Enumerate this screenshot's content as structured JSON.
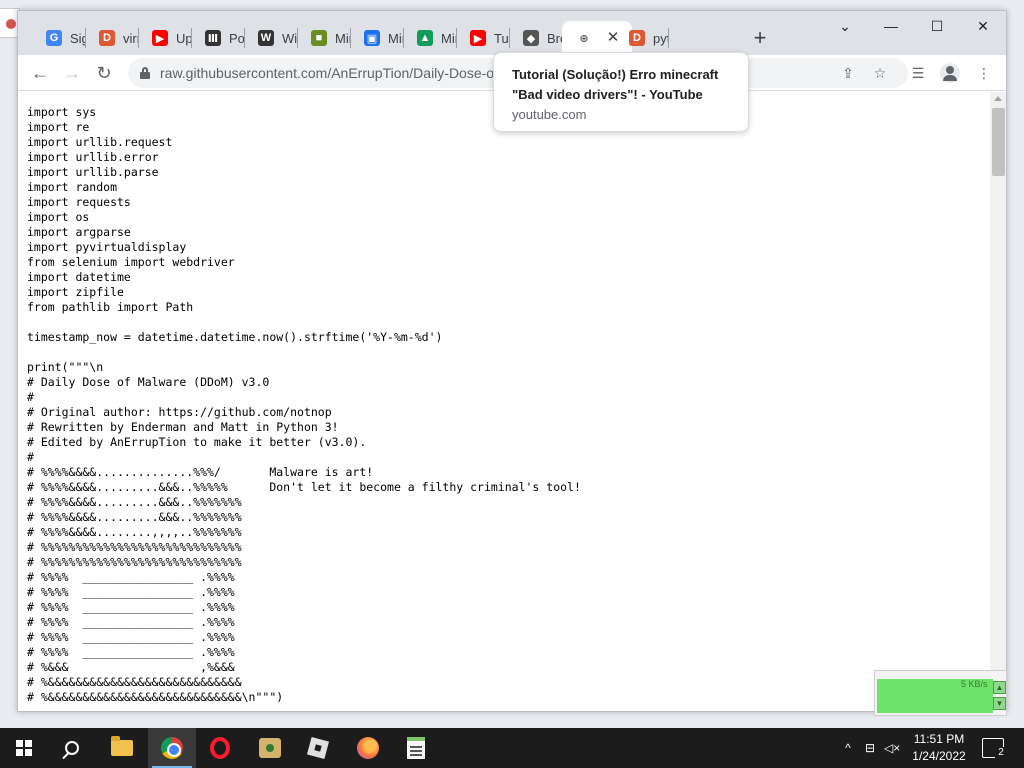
{
  "browser": {
    "tabs": [
      {
        "title": "Sign",
        "icon": "G",
        "color": "#4285f4"
      },
      {
        "title": "virn",
        "icon": "D",
        "color": "#de5833"
      },
      {
        "title": "Upd",
        "icon": "▶",
        "color": "#ff0000"
      },
      {
        "title": "Pos",
        "icon": "Ⅲ",
        "color": "#333333"
      },
      {
        "title": "Wir",
        "icon": "W",
        "color": "#333333"
      },
      {
        "title": "Min",
        "icon": "■",
        "color": "#6b8e23"
      },
      {
        "title": "Min",
        "icon": "▣",
        "color": "#1a73e8"
      },
      {
        "title": "Min",
        "icon": "▲",
        "color": "#0f9d58"
      },
      {
        "title": "Tuto",
        "icon": "▶",
        "color": "#ff0000"
      },
      {
        "title": "Bro",
        "icon": "◆",
        "color": "#555555"
      },
      {
        "title": "",
        "icon": "⊕",
        "color": "#5f6368",
        "active": true
      },
      {
        "title": "pyth",
        "icon": "D",
        "color": "#de5833"
      }
    ],
    "new_tab_symbol": "+",
    "window_controls": {
      "dropdown": "⌄",
      "minimize": "—",
      "maximize": "☐",
      "close": "✕"
    },
    "nav": {
      "back": "←",
      "forward": "→",
      "reload": "↻"
    },
    "address_bar": {
      "url": "raw.githubusercontent.com/AnErrupTion/Daily-Dose-of"
    },
    "toolbar_icons": {
      "share": "⇪",
      "bookmark": "☆",
      "reading_list": "☰",
      "menu": "⋮"
    }
  },
  "tooltip": {
    "title_line1": "Tutorial (Solução!) Erro minecraft",
    "title_line2": "\"Bad video drivers\"! - YouTube",
    "host": "youtube.com"
  },
  "code_lines": [
    "import sys",
    "import re",
    "import urllib.request",
    "import urllib.error",
    "import urllib.parse",
    "import random",
    "import requests",
    "import os",
    "import argparse",
    "import pyvirtualdisplay",
    "from selenium import webdriver",
    "import datetime",
    "import zipfile",
    "from pathlib import Path",
    "",
    "timestamp_now = datetime.datetime.now().strftime('%Y-%m-%d')",
    "",
    "print(\"\"\"\\n",
    "# Daily Dose of Malware (DDoM) v3.0",
    "#",
    "# Original author: https://github.com/notnop",
    "# Rewritten by Enderman and Matt in Python 3!",
    "# Edited by AnErrupTion to make it better (v3.0).",
    "#",
    "# %%%%&&&&..............%%%/       Malware is art!",
    "# %%%%&&&&.........&&&..%%%%%      Don't let it become a filthy criminal's tool!",
    "# %%%%&&&&.........&&&..%%%%%%%",
    "# %%%%&&&&.........&&&..%%%%%%%",
    "# %%%%&&&&........,,,,..%%%%%%%",
    "# %%%%%%%%%%%%%%%%%%%%%%%%%%%%%",
    "# %%%%%%%%%%%%%%%%%%%%%%%%%%%%%",
    "# %%%%  ________________ .%%%%",
    "# %%%%  ________________ .%%%%",
    "# %%%%  ________________ .%%%%",
    "# %%%%  ________________ .%%%%",
    "# %%%%  ________________ .%%%%",
    "# %%%%  ________________ .%%%%",
    "# %&&&                   ,%&&&",
    "# %&&&&&&&&&&&&&&&&&&&&&&&&&&&&",
    "# %&&&&&&&&&&&&&&&&&&&&&&&&&&&&\\n\"\"\")"
  ],
  "net_meter": {
    "speed": "5 KB/s",
    "up_btn": "▲",
    "down_btn": "▼"
  },
  "taskbar": {
    "tray": {
      "chevron": "^",
      "network": "⊟",
      "volume": "◁×"
    },
    "clock_time": "11:51 PM",
    "clock_date": "1/24/2022",
    "notification_count": "2"
  }
}
